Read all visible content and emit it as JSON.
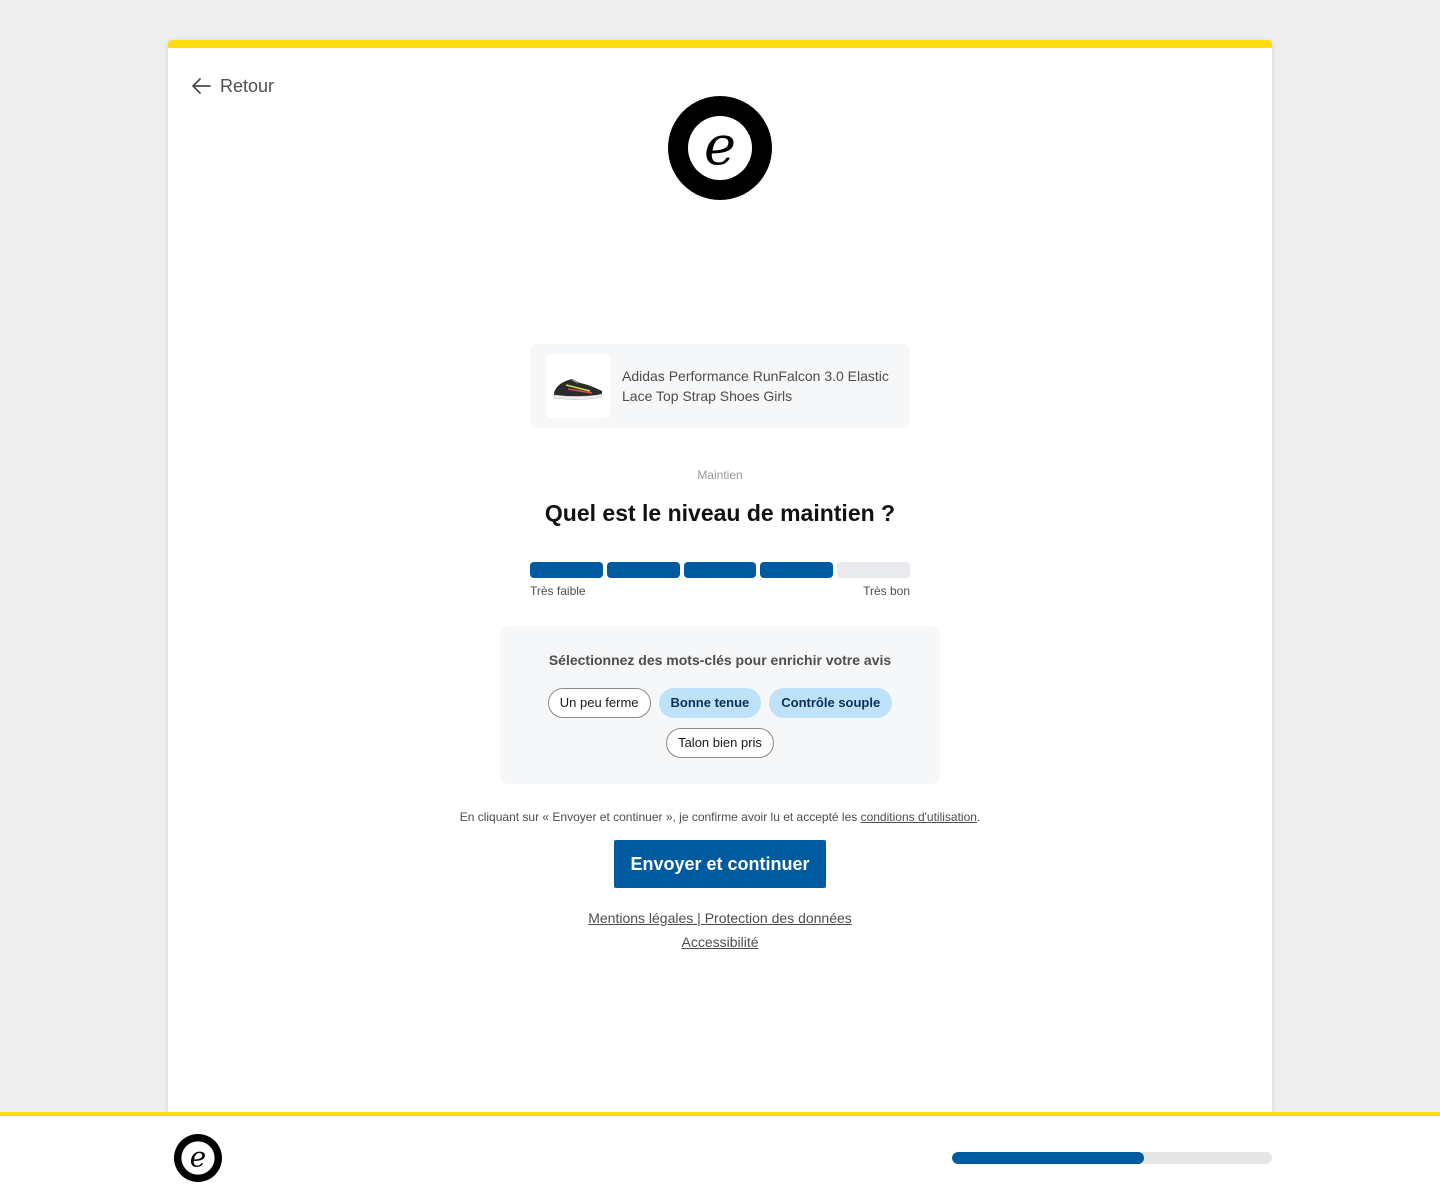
{
  "nav": {
    "back_label": "Retour"
  },
  "brand": {
    "logo_letter": "e",
    "accent_color": "#ffdc0f",
    "primary_color": "#005aa0"
  },
  "product": {
    "name_line1": "Adidas Performance RunFalcon 3.0 Elastic",
    "name_line2": "Lace Top Strap Shoes Girls",
    "image_icon": "shoe-image"
  },
  "question": {
    "section": "Maintien",
    "title": "Quel est le niveau de maintien ?",
    "scale_min_label": "Très faible",
    "scale_max_label": "Très bon",
    "rating_value": 4,
    "rating_max": 5
  },
  "keywords": {
    "title": "Sélectionnez des mots-clés pour enrichir votre avis",
    "chips": [
      {
        "label": "Un peu ferme",
        "selected": false
      },
      {
        "label": "Bonne tenue",
        "selected": true
      },
      {
        "label": "Contrôle souple",
        "selected": true
      },
      {
        "label": "Talon bien pris",
        "selected": false
      }
    ]
  },
  "consent": {
    "text": "En cliquant sur « Envoyer et continuer », je confirme avoir lu et accepté les ",
    "link_label": "conditions d'utilisation",
    "suffix": "."
  },
  "submit_label": "Envoyer et continuer",
  "footer": {
    "legal_label": "Mentions légales",
    "separator": " | ",
    "privacy_label": "Protection des données",
    "accessibility_label": "Accessibilité"
  },
  "progress": {
    "fraction": 0.6
  }
}
